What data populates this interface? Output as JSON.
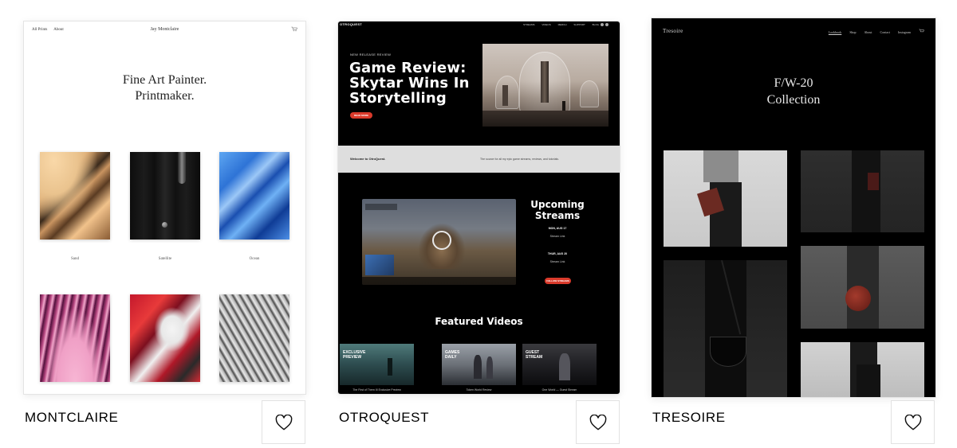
{
  "cards": [
    {
      "name": "MONTCLAIRE",
      "preview": {
        "nav_links": [
          "All Prints",
          "About"
        ],
        "brand": "Jay Montclaire",
        "hero_lines": [
          "Fine Art Painter.",
          "Printmaker."
        ],
        "captions": [
          "Sand",
          "Satellite",
          "Ocean"
        ]
      }
    },
    {
      "name": "OTROQUEST",
      "preview": {
        "logo": "OTROQUEST",
        "nav_links": [
          "STREAMS",
          "VIDEOS",
          "MERCH",
          "SUPPORT",
          "BLOG"
        ],
        "kicker": "NEW RELEASE REVIEW",
        "title_lines": [
          "Game Review:",
          "Skytar Wins In",
          "Storytelling"
        ],
        "read_more": "READ MORE",
        "band_left": "Welcome to OtroQuest.",
        "band_right": "The source for all my epic game streams, reviews, and tutorials.",
        "upcoming_lines": [
          "Upcoming",
          "Streams"
        ],
        "dates": [
          "MON, AUG 17",
          "THUR, AUG 20"
        ],
        "stream_link": "Stream Link",
        "follow": "FOLLOW STREAMS",
        "featured": "Featured Videos",
        "videos": [
          {
            "tag": "EXCLUSIVE PREVIEW",
            "caption": "The First of Them III Exclusive Preview"
          },
          {
            "tag": "GAMES DAILY",
            "caption": "Token World Review"
          },
          {
            "tag": "GUEST STREAM",
            "caption": "One World — Guest Stream"
          }
        ]
      }
    },
    {
      "name": "TRESOIRE",
      "preview": {
        "logo": "Tresoire",
        "nav_links": [
          "Lookbook",
          "Shop",
          "About",
          "Contact",
          "Instagram"
        ],
        "hero_lines": [
          "F/W-20",
          "Collection"
        ]
      }
    }
  ]
}
